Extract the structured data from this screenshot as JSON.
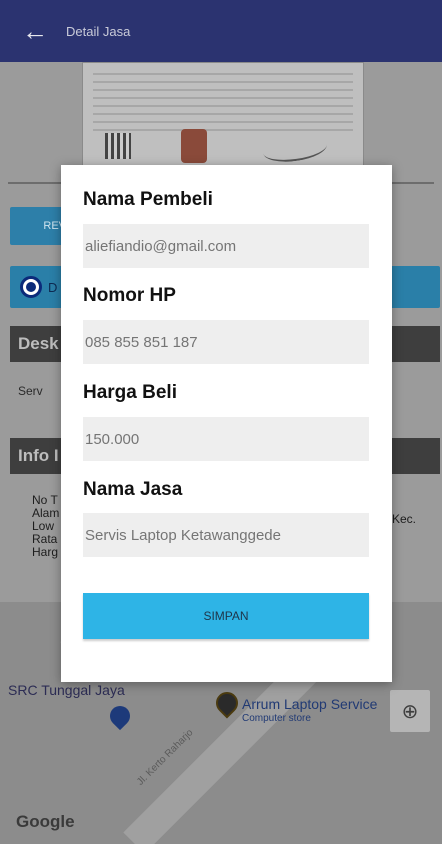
{
  "appbar": {
    "back_icon": "arrow-left-icon",
    "title": "Detail Jasa"
  },
  "background": {
    "review_button_label": "REV",
    "radio_label": "D",
    "section_description_title": "Desk",
    "description_text": "Serv",
    "section_info_title": "Info I",
    "info_lines": [
      "No T",
      "Alam",
      "Low",
      "Rata",
      "Harg"
    ],
    "info_tail": "Kec."
  },
  "map": {
    "place_1": "SRC Tunggal Jaya",
    "place_2": "Arrum Laptop Service",
    "place_2_sub": "Computer store",
    "road": "Jl. Kerto Raharjo",
    "google_logo": "Google",
    "locate_icon": "my-location-icon"
  },
  "dialog": {
    "buyer_label": "Nama Pembeli",
    "buyer_placeholder": "aliefiandio@gmail.com",
    "phone_label": "Nomor HP",
    "phone_placeholder": "085 855 851 187",
    "price_label": "Harga Beli",
    "price_placeholder": "150.000",
    "service_label": "Nama Jasa",
    "service_placeholder": "Servis Laptop Ketawanggede",
    "save_label": "SIMPAN"
  },
  "colors": {
    "appbar": "#2b3370",
    "accent_button": "#2eb4e6",
    "input_background": "#eeeeee"
  }
}
